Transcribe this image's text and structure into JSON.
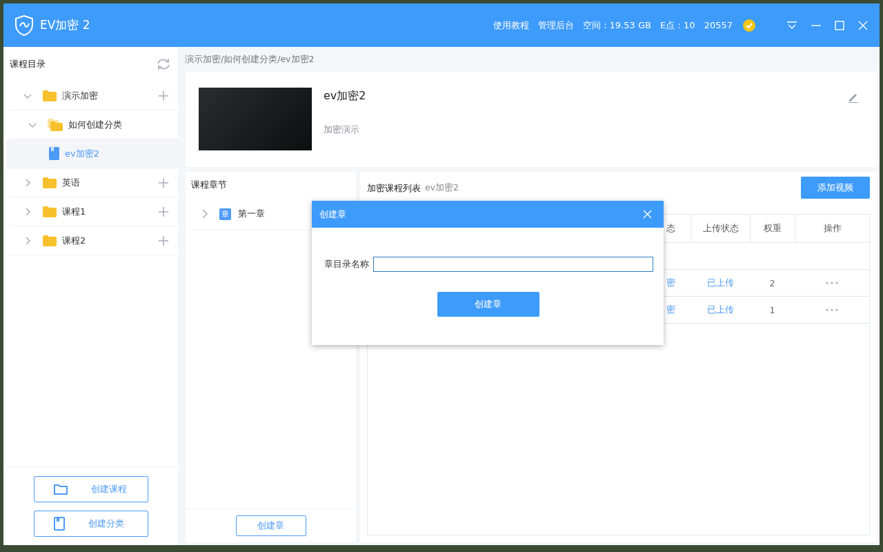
{
  "window": {
    "title": "EV加密 2"
  },
  "header_links": [
    "使用教程",
    "管理后台"
  ],
  "stats": {
    "space": "空间：19.53 GB",
    "points": "E点：10",
    "user_id": "20557"
  },
  "sidebar": {
    "title": "课程目录",
    "tree": [
      {
        "label": "演示加密",
        "kind": "folder",
        "expanded": true,
        "selected": false,
        "children": [
          {
            "label": "如何创建分类",
            "kind": "open-folder",
            "expanded": true,
            "selected": false,
            "children": [
              {
                "label": "ev加密2",
                "kind": "book",
                "selected": true
              }
            ]
          }
        ]
      },
      {
        "label": "英语",
        "kind": "folder",
        "expanded": false,
        "selected": false
      },
      {
        "label": "课程1",
        "kind": "folder",
        "expanded": false,
        "selected": false
      },
      {
        "label": "课程2",
        "kind": "folder",
        "expanded": false,
        "selected": false
      }
    ],
    "buttons": [
      {
        "label": "创建课程",
        "kind": "folder"
      },
      {
        "label": "创建分类",
        "kind": "book"
      }
    ]
  },
  "breadcrumb": "演示加密/如何创建分类/ev加密2",
  "course": {
    "title": "ev加密2",
    "subtitle": "加密演示"
  },
  "chapters": {
    "title": "课程章节",
    "items": [
      {
        "badge": "章",
        "label": "第一章",
        "expanded": false
      }
    ],
    "button": "创建章"
  },
  "video_list": {
    "title": "加密课程列表",
    "course": "ev加密2",
    "add_button": "添加视频",
    "columns": [
      "态",
      "上传状态",
      "权重",
      "操作"
    ],
    "rows": [
      {
        "column_1": "密",
        "upload_status": "已上传",
        "weight": "2"
      },
      {
        "column_1": "密",
        "upload_status": "已上传",
        "weight": "1"
      }
    ]
  },
  "dialog": {
    "title": "创建章",
    "field_label": "章目录名称",
    "button": "创建章"
  }
}
